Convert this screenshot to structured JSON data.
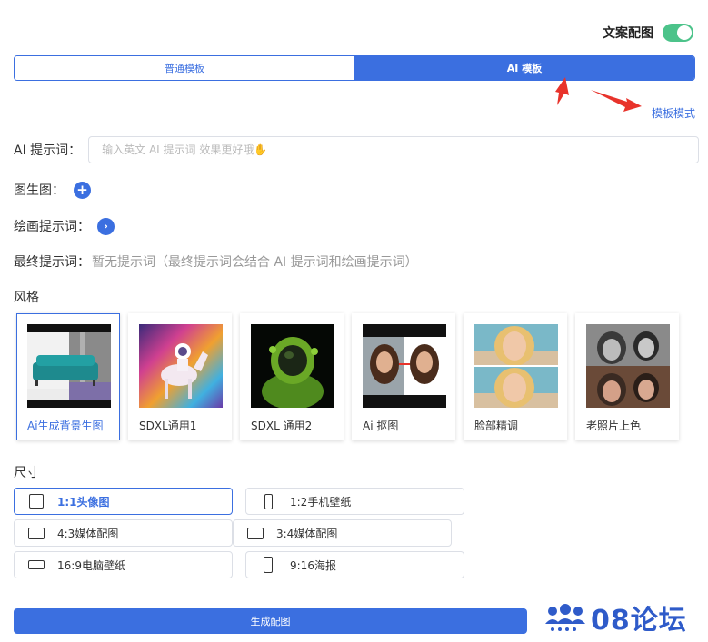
{
  "header": {
    "toggle_label": "文案配图",
    "toggle_on": true
  },
  "tabs": [
    {
      "label": "普通模板",
      "active": false
    },
    {
      "label": "AI 模板",
      "active": true
    }
  ],
  "mode_link": "模板模式",
  "ai_prompt": {
    "label": "AI 提示词：",
    "placeholder": "输入英文 AI 提示词 效果更好哦✋",
    "value": ""
  },
  "img2img": {
    "label": "图生图：",
    "icon": "plus-icon"
  },
  "draw_prompt": {
    "label": "绘画提示词：",
    "icon": "chevron-right-icon"
  },
  "final_prompt": {
    "label": "最终提示词：",
    "value": "暂无提示词（最终提示词会结合 AI 提示词和绘画提示词）"
  },
  "style_section": {
    "title": "风格",
    "items": [
      {
        "name": "Ai生成背景生图",
        "selected": true
      },
      {
        "name": "SDXL通用1",
        "selected": false
      },
      {
        "name": "SDXL 通用2",
        "selected": false
      },
      {
        "name": "Ai 抠图",
        "selected": false
      },
      {
        "name": "脸部精调",
        "selected": false
      },
      {
        "name": "老照片上色",
        "selected": false
      }
    ]
  },
  "size_section": {
    "title": "尺寸",
    "items": [
      {
        "label": "1:1头像图",
        "active": true
      },
      {
        "label": "1:2手机壁纸",
        "active": false
      },
      {
        "label": "4:3媒体配图",
        "active": false
      },
      {
        "label": "3:4媒体配图",
        "active": false
      },
      {
        "label": "16:9电脑壁纸",
        "active": false
      },
      {
        "label": "9:16海报",
        "active": false
      }
    ]
  },
  "generate_button": "生成配图",
  "watermark": "08论坛",
  "colors": {
    "primary": "#3b6fe0",
    "toggle": "#4cc38a",
    "arrow": "#e8332b"
  }
}
